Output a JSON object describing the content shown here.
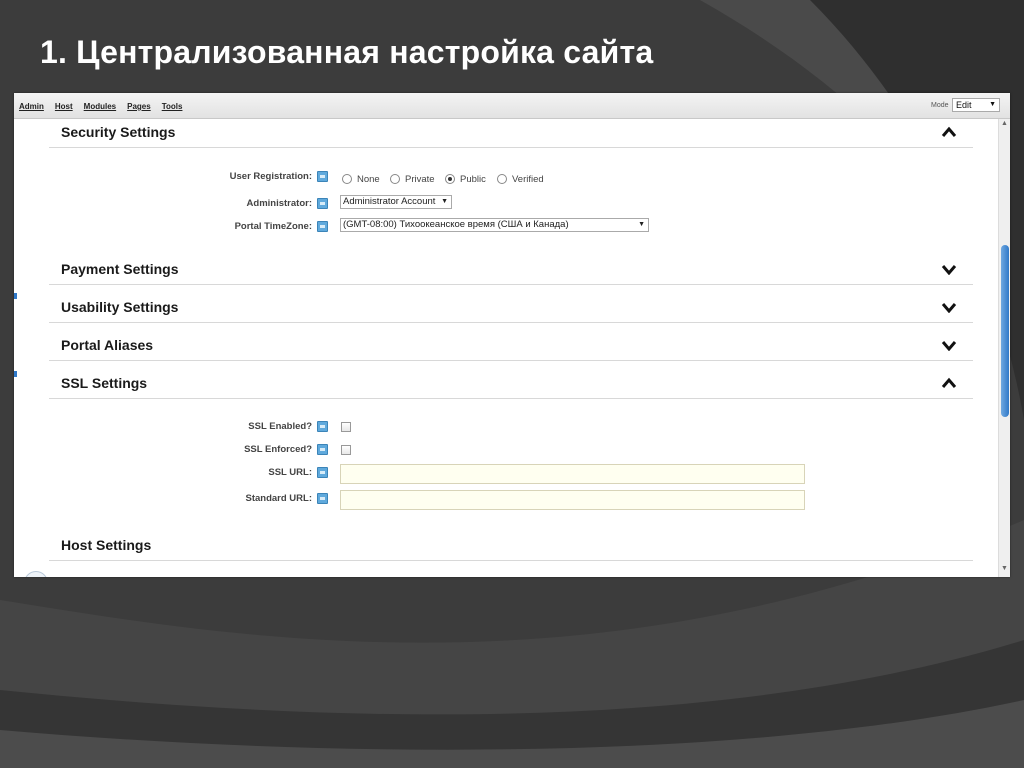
{
  "slide": {
    "title": "1. Централизованная настройка сайта"
  },
  "toolbar": {
    "menu": [
      "Admin",
      "Host",
      "Modules",
      "Pages",
      "Tools"
    ],
    "mode_label": "Mode",
    "mode_value": "Edit"
  },
  "sections": {
    "security": {
      "title": "Security Settings",
      "expanded": true
    },
    "payment": {
      "title": "Payment Settings",
      "expanded": false
    },
    "usability": {
      "title": "Usability Settings",
      "expanded": false
    },
    "aliases": {
      "title": "Portal Aliases",
      "expanded": false
    },
    "ssl": {
      "title": "SSL Settings",
      "expanded": true
    },
    "host": {
      "title": "Host Settings",
      "expanded": false
    }
  },
  "security": {
    "user_registration": {
      "label": "User Registration:",
      "options": [
        "None",
        "Private",
        "Public",
        "Verified"
      ],
      "selected": "Public"
    },
    "administrator": {
      "label": "Administrator:",
      "value": "Administrator Account"
    },
    "timezone": {
      "label": "Portal TimeZone:",
      "value": "(GMT-08:00) Тихоокеанское время (США и Канада)"
    }
  },
  "ssl": {
    "enabled_label": "SSL Enabled?",
    "enabled": false,
    "enforced_label": "SSL Enforced?",
    "enforced": false,
    "url_label": "SSL URL:",
    "url_value": "",
    "standard_url_label": "Standard URL:",
    "standard_url_value": ""
  },
  "colors": {
    "slide_background": "#3a3a3a",
    "accent_blue": "#2f78c8",
    "input_background": "#fffff0"
  }
}
